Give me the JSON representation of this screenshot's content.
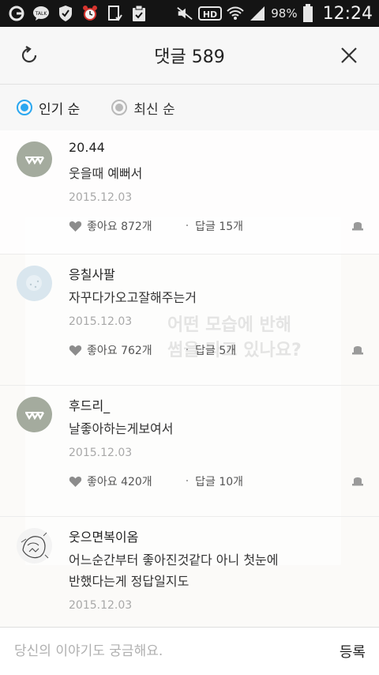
{
  "status_bar": {
    "battery_percent": "98%",
    "time": "12:24",
    "notification_icons": [
      "g-icon",
      "kakaotalk-icon",
      "shield-icon",
      "alarm-clock-icon",
      "download-check-icon",
      "clipboard-check-icon"
    ],
    "system_icons": [
      "mute-icon",
      "hd-icon",
      "wifi-icon",
      "signal-icon",
      "battery-icon"
    ],
    "talk_label": "TALK",
    "hd_label": "HD"
  },
  "header": {
    "title": "댓글 589"
  },
  "sort": {
    "options": [
      {
        "label": "인기 순",
        "selected": true
      },
      {
        "label": "최신 순",
        "selected": false
      }
    ]
  },
  "comments": [
    {
      "name": "20.44",
      "text": "웃을때 예뻐서",
      "date": "2015.12.03",
      "likes": "좋아요 872개",
      "replies": "답글 15개"
    },
    {
      "name": "응칠사팔",
      "text": "자꾸다가오고잘해주는거",
      "date": "2015.12.03",
      "likes": "좋아요 762개",
      "replies": "답글 5개"
    },
    {
      "name": "후드리_",
      "text": "날좋아하는게보여서",
      "date": "2015.12.03",
      "likes": "좋아요 420개",
      "replies": "답글 10개"
    },
    {
      "name": "웃으면복이옴",
      "text_lines": [
        "어느순간부터 좋아진것같다 아니 첫눈에",
        "반했다는게 정답일지도"
      ],
      "date": "2015.12.03"
    }
  ],
  "background_card_text": [
    "어떤 모습에 반해",
    "썸을 타고 있나요?"
  ],
  "input": {
    "placeholder": "당신의 이야기도 궁금해요.",
    "submit_label": "등록"
  },
  "colors": {
    "accent": "#2aa7f0",
    "status_bar": "#141414"
  }
}
